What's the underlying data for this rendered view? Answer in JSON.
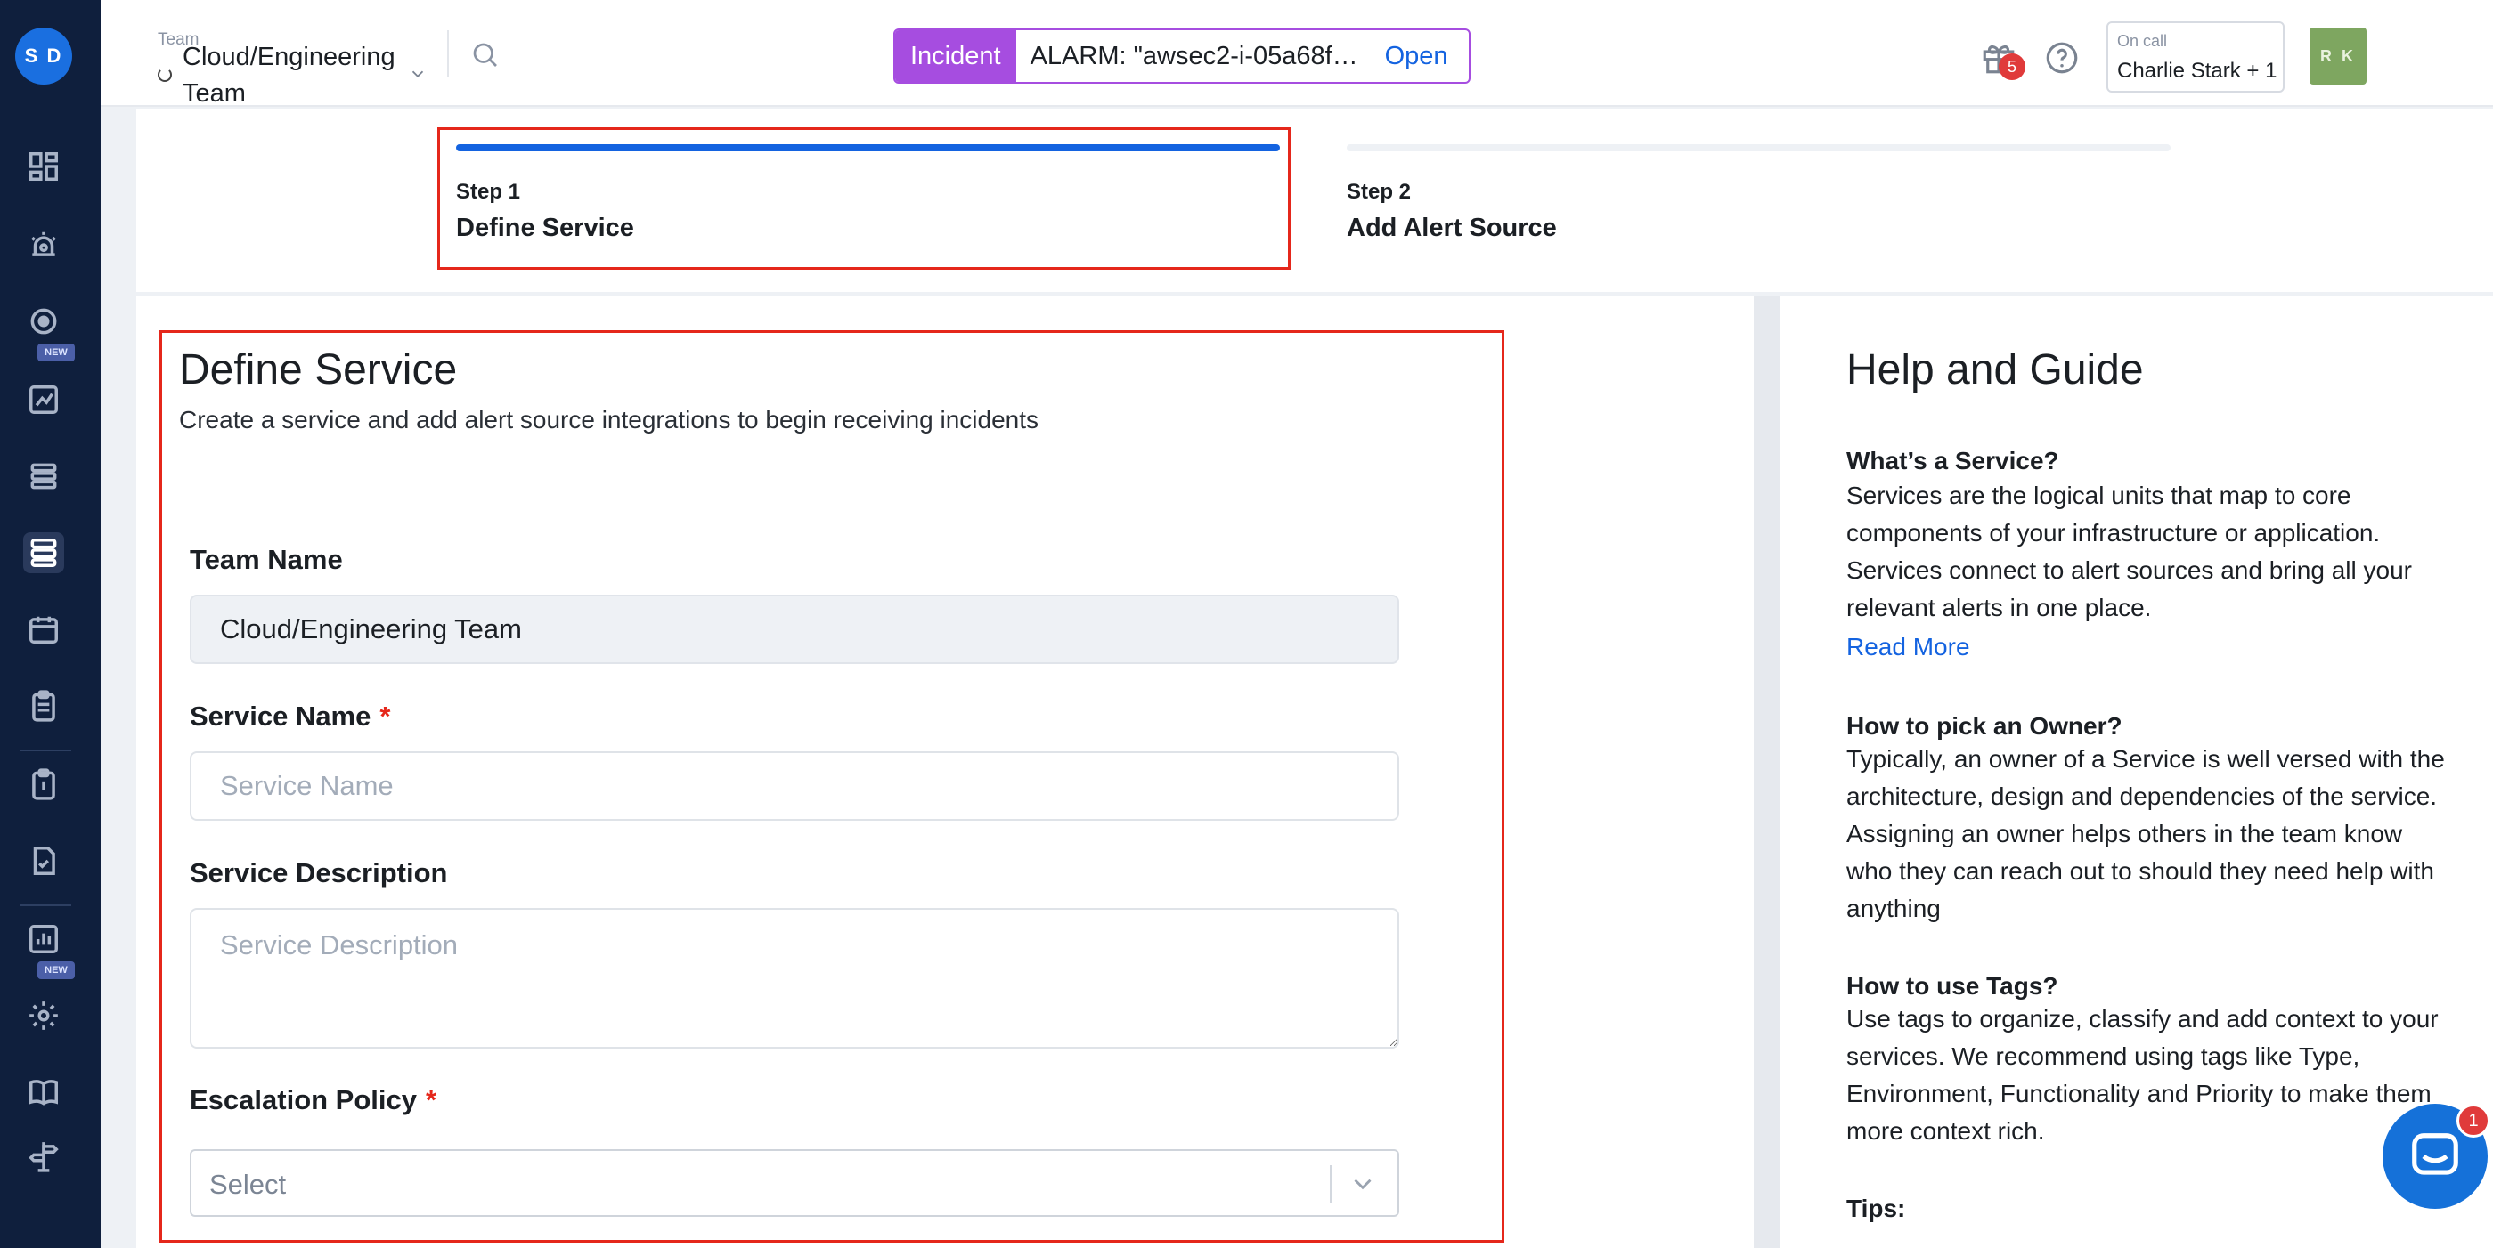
{
  "sidebar": {
    "user_initials": "S D",
    "badge_new": "NEW",
    "items": [
      {
        "icon": "dashboard-icon"
      },
      {
        "icon": "alarm-siren-icon"
      },
      {
        "icon": "status-target-icon",
        "badge": "NEW"
      },
      {
        "icon": "analytics-icon"
      },
      {
        "icon": "list-icon"
      },
      {
        "icon": "services-icon",
        "active": true
      },
      {
        "icon": "calendar-icon"
      },
      {
        "icon": "clipboard-icon"
      },
      {
        "icon": "runbook-icon"
      },
      {
        "icon": "checklist-icon"
      },
      {
        "icon": "reports-icon",
        "badge": "NEW"
      },
      {
        "icon": "settings-gear-icon"
      },
      {
        "icon": "book-icon"
      },
      {
        "icon": "signpost-icon"
      }
    ]
  },
  "topbar": {
    "team_label": "Team",
    "team_name": "Cloud/Engineering Team",
    "incident": {
      "tag": "Incident",
      "text": "ALARM: \"awsec2-i-05a68f…",
      "status": "Open"
    },
    "notifications_count": "5",
    "oncall_label": "On call",
    "oncall_name": "Charlie Stark + 1",
    "user_initials": "R K"
  },
  "stepper": {
    "steps": [
      {
        "number": "Step 1",
        "title": "Define Service",
        "active": true
      },
      {
        "number": "Step 2",
        "title": "Add Alert Source",
        "active": false
      }
    ]
  },
  "form": {
    "title": "Define Service",
    "subtitle": "Create a service and add alert source integrations to begin receiving incidents",
    "team_name_label": "Team Name",
    "team_name_value": "Cloud/Engineering Team",
    "service_name_label": "Service Name",
    "service_name_placeholder": "Service Name",
    "required_mark": "*",
    "service_description_label": "Service Description",
    "service_description_placeholder": "Service Description",
    "escalation_policy_label": "Escalation Policy",
    "escalation_policy_value": "Select"
  },
  "help": {
    "title": "Help and Guide",
    "sections": [
      {
        "heading": "What’s a Service?",
        "body": "Services are the logical units that map to core components of your infrastructure or application. Services connect to alert sources and bring all your relevant alerts in one place."
      },
      {
        "heading": "How to pick an Owner?",
        "body": "Typically, an owner of a Service is well versed with the architecture, design and dependencies of the service. Assigning an owner helps others in the team know who they can reach out to should they need help with anything"
      },
      {
        "heading": "How to use Tags?",
        "body": "Use tags to organize, classify and add context to your services. We recommend using tags like Type, Environment, Functionality and Priority to make them more context rich."
      },
      {
        "heading": "Tips:",
        "body": ""
      }
    ],
    "read_more": "Read More"
  },
  "chat": {
    "unread_count": "1"
  },
  "colors": {
    "sidebar_bg": "#0f1f3d",
    "accent_blue": "#1463e0",
    "incident_purple": "#a64de0",
    "highlight_red": "#e5271b"
  }
}
